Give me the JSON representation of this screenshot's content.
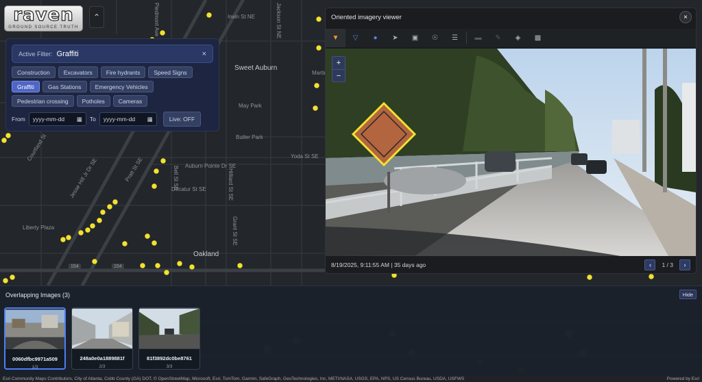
{
  "logo": {
    "brand": "raven",
    "tagline": "GROUND SOURCE TRUTH"
  },
  "map": {
    "labels": {
      "sweet_auburn": "Sweet Auburn",
      "oakland": "Oakland",
      "liberty_plaza": "Liberty Plaza",
      "irwin": "Irwin St NE",
      "auburn": "Auburn Pointe Dr SE",
      "decatur": "Decatur St SE",
      "hilliard": "Hilliard St SE",
      "grant": "Grant St SE",
      "pratt": "Pratt St SE",
      "bell": "Bell St SE",
      "butler_park": "Butler Park",
      "yoda": "Yoda St SE",
      "jackson": "Jackson St NE",
      "may_park": "May Park",
      "martin": "Martin Luther",
      "piedmont": "Piedmont Ave NE",
      "courtland": "Courtland St",
      "jesse_hill": "Jesse Hill Jr Dr SE"
    },
    "route_shields": [
      "154",
      "154"
    ]
  },
  "filter_panel": {
    "active_label": "Active Filter:",
    "active_value": "Graffiti",
    "clear_icon": "×",
    "chips": [
      {
        "label": "Construction",
        "active": false
      },
      {
        "label": "Excavators",
        "active": false
      },
      {
        "label": "Fire hydrants",
        "active": false
      },
      {
        "label": "Speed Signs",
        "active": false
      },
      {
        "label": "Graffiti",
        "active": true
      },
      {
        "label": "Gas Stations",
        "active": false
      },
      {
        "label": "Emergency Vehicles",
        "active": false
      },
      {
        "label": "Pedestrian crossing",
        "active": false
      },
      {
        "label": "Potholes",
        "active": false
      },
      {
        "label": "Cameras",
        "active": false
      }
    ],
    "from_label": "From",
    "to_label": "To",
    "date_placeholder": "yyyy-mm-dd",
    "live_label": "Live: OFF"
  },
  "viewer": {
    "title": "Oriented imagery viewer",
    "close_icon": "×",
    "timestamp": "8/19/2025, 9:11:55 AM | 35 days ago",
    "page": "1 / 3",
    "zoom_in": "+",
    "zoom_out": "−",
    "prev_icon": "‹",
    "next_icon": "›"
  },
  "bottom": {
    "title": "Overlapping Images (3)",
    "hide_label": "Hide",
    "thumbnails": [
      {
        "id": "0060dfbc9971a509",
        "page": "1/3"
      },
      {
        "id": "248a0e0a1889881f",
        "page": "2/3"
      },
      {
        "id": "81f3892dc0be8761",
        "page": "3/3"
      }
    ]
  },
  "attribution": "Esri Community Maps Contributors, City of Atlanta, Cobb County (GA) DOT, © OpenStreetMap, Microsoft, Esri, TomTom, Garmin, SafeGraph, GeoTechnologies, Inc, METI/NASA, USGS, EPA, NPS, US Census Bureau, USDA, USFWS",
  "powered_by": "Powered by Esri",
  "colors": {
    "accent": "#4e66c4",
    "marker": "#f2e22e",
    "active_tool": "#f59a2a"
  }
}
